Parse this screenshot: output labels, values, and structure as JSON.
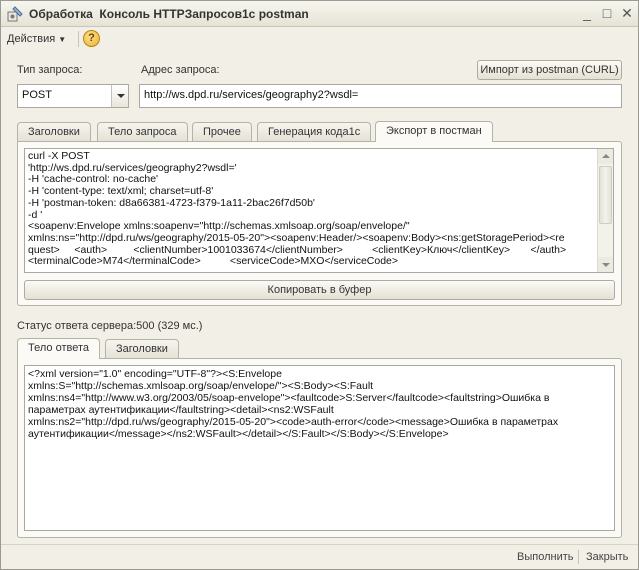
{
  "window": {
    "title": "Обработка  Консоль HTTPЗапросов1с postman",
    "minimize_glyph": "_",
    "maximize_glyph": "□",
    "close_glyph": "✕"
  },
  "toolbar": {
    "actions_label": "Действия",
    "help_glyph": "?"
  },
  "request": {
    "type_label": "Тип запроса:",
    "type_value": "POST",
    "address_label": "Адрес запроса:",
    "address_value": "http://ws.dpd.ru/services/geography2?wsdl=",
    "import_button": "Импорт из postman (CURL)"
  },
  "request_tabs": [
    {
      "label": "Заголовки",
      "active": false
    },
    {
      "label": "Тело запроса",
      "active": false
    },
    {
      "label": "Прочее",
      "active": false
    },
    {
      "label": "Генерация кода1с",
      "active": false
    },
    {
      "label": "Экспорт в постман",
      "active": true
    }
  ],
  "export": {
    "lines": [
      "curl -X POST",
      "'http://ws.dpd.ru/services/geography2?wsdl='",
      "-H 'cache-control: no-cache'",
      "-H 'content-type: text/xml; charset=utf-8'",
      "-H 'postman-token: d8a66381-4723-f379-1a11-2bac26f7d50b'",
      "-d '",
      "<soapenv:Envelope xmlns:soapenv=\"http://schemas.xmlsoap.org/soap/envelope/\"",
      "xmlns:ns=\"http://dpd.ru/ws/geography/2015-05-20\"><soapenv:Header/><soapenv:Body><ns:getStoragePeriod><re",
      "quest>     <auth>         <clientNumber>1001033674</clientNumber>          <clientKey>Ключ</clientKey>       </auth>",
      "<terminalCode>M74</terminalCode>          <serviceCode>MXO</serviceCode>"
    ],
    "copy_button": "Копировать в буфер"
  },
  "status": {
    "text": "Статус ответа сервера:500 (329 мс.)"
  },
  "response_tabs": [
    {
      "label": "Тело ответа",
      "active": true
    },
    {
      "label": "Заголовки",
      "active": false
    }
  ],
  "response": {
    "lines": [
      "<?xml version=\"1.0\" encoding=\"UTF-8\"?><S:Envelope",
      "xmlns:S=\"http://schemas.xmlsoap.org/soap/envelope/\"><S:Body><S:Fault",
      "xmlns:ns4=\"http://www.w3.org/2003/05/soap-envelope\"><faultcode>S:Server</faultcode><faultstring>Ошибка в",
      "параметрах аутентификации</faultstring><detail><ns2:WSFault",
      "xmlns:ns2=\"http://dpd.ru/ws/geography/2015-05-20\"><code>auth-error</code><message>Ошибка в параметрах",
      "аутентификации</message></ns2:WSFault></detail></S:Fault></S:Body></S:Envelope>"
    ]
  },
  "footer": {
    "execute_label": "Выполнить",
    "close_label": "Закрыть"
  }
}
